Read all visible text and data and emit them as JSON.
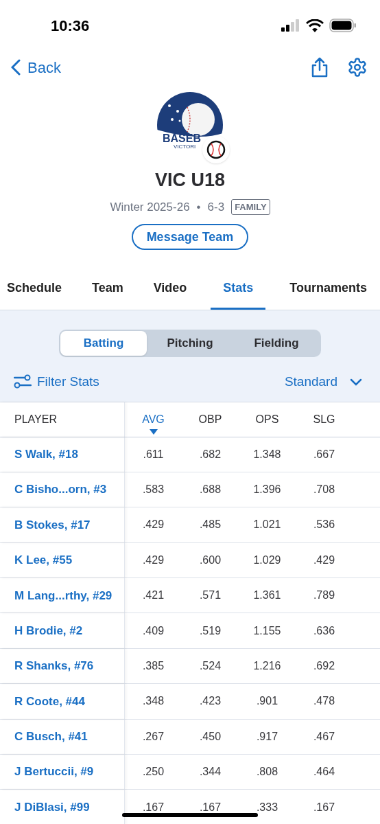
{
  "status_bar": {
    "time": "10:36"
  },
  "nav": {
    "back": "Back"
  },
  "team": {
    "logo_text": [
      "BASEB",
      "VICTORI"
    ],
    "name": "VIC U18",
    "season": "Winter 2025-26",
    "separator": "•",
    "record": "6-3",
    "badge": "FAMILY",
    "message_button": "Message Team"
  },
  "tabs": [
    {
      "label": "Schedule",
      "selected": false
    },
    {
      "label": "Team",
      "selected": false
    },
    {
      "label": "Video",
      "selected": false
    },
    {
      "label": "Stats",
      "selected": true
    },
    {
      "label": "Tournaments",
      "selected": false
    }
  ],
  "segments": [
    {
      "label": "Batting",
      "selected": true
    },
    {
      "label": "Pitching",
      "selected": false
    },
    {
      "label": "Fielding",
      "selected": false
    }
  ],
  "filter": {
    "label": "Filter Stats",
    "view": "Standard"
  },
  "table": {
    "columns": [
      {
        "label": "PLAYER",
        "sorted": false
      },
      {
        "label": "AVG",
        "sorted": true
      },
      {
        "label": "OBP",
        "sorted": false
      },
      {
        "label": "OPS",
        "sorted": false
      },
      {
        "label": "SLG",
        "sorted": false
      }
    ],
    "rows": [
      [
        "S Walk, #18",
        ".611",
        ".682",
        "1.348",
        ".667"
      ],
      [
        "C Bisho...orn, #3",
        ".583",
        ".688",
        "1.396",
        ".708"
      ],
      [
        "B Stokes, #17",
        ".429",
        ".485",
        "1.021",
        ".536"
      ],
      [
        "K Lee, #55",
        ".429",
        ".600",
        "1.029",
        ".429"
      ],
      [
        "M Lang...rthy, #29",
        ".421",
        ".571",
        "1.361",
        ".789"
      ],
      [
        "H Brodie, #2",
        ".409",
        ".519",
        "1.155",
        ".636"
      ],
      [
        "R Shanks, #76",
        ".385",
        ".524",
        "1.216",
        ".692"
      ],
      [
        "R Coote, #44",
        ".348",
        ".423",
        ".901",
        ".478"
      ],
      [
        "C Busch, #41",
        ".267",
        ".450",
        ".917",
        ".467"
      ],
      [
        "J Bertuccii, #9",
        ".250",
        ".344",
        ".808",
        ".464"
      ],
      [
        "J DiBlasi, #99",
        ".167",
        ".167",
        ".333",
        ".167"
      ]
    ]
  }
}
